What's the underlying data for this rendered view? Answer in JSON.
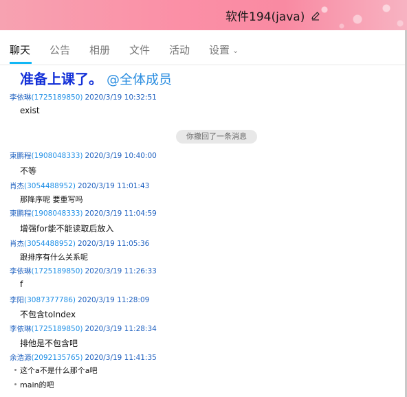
{
  "window": {
    "title": "软件194(java)"
  },
  "tabs": [
    {
      "label": "聊天"
    },
    {
      "label": "公告"
    },
    {
      "label": "相册"
    },
    {
      "label": "文件"
    },
    {
      "label": "活动"
    },
    {
      "label": "设置"
    }
  ],
  "top_message": {
    "bold_text": "准备上课了。",
    "mention": "@全体成员"
  },
  "recall_notice": "你撤回了一条消息",
  "messages": [
    {
      "name": "李依琳",
      "qq": "(1725189850)",
      "time": "2020/3/19 10:32:51",
      "body": [
        "exist"
      ]
    },
    {
      "name": "柬鹏程",
      "qq": "(1908048333)",
      "time": "2020/3/19 10:40:00",
      "body": [
        "不等"
      ]
    },
    {
      "name": "肖杰",
      "qq": "(3054488952)",
      "time": "2020/3/19 11:01:43",
      "body": [
        "那降序呢 要重写吗"
      ]
    },
    {
      "name": "柬鹏程",
      "qq": "(1908048333)",
      "time": "2020/3/19 11:04:59",
      "body": [
        "增强for能不能读取后放入"
      ]
    },
    {
      "name": "肖杰",
      "qq": "(3054488952)",
      "time": "2020/3/19 11:05:36",
      "body": [
        "跟排序有什么关系呢"
      ]
    },
    {
      "name": "李依琳",
      "qq": "(1725189850)",
      "time": "2020/3/19 11:26:33",
      "body": [
        "f"
      ]
    },
    {
      "name": "李阳",
      "qq": "(3087377786)",
      "time": "2020/3/19 11:28:09",
      "body": [
        "不包含toIndex"
      ]
    },
    {
      "name": "李依琳",
      "qq": "(1725189850)",
      "time": "2020/3/19 11:28:34",
      "body": [
        "排他是不包含吧"
      ]
    },
    {
      "name": "余浩源",
      "qq": "(2092135765)",
      "time": "2020/3/19 11:41:35",
      "body": [
        "这个a不是什么那个a吧",
        "main的吧"
      ]
    }
  ]
}
